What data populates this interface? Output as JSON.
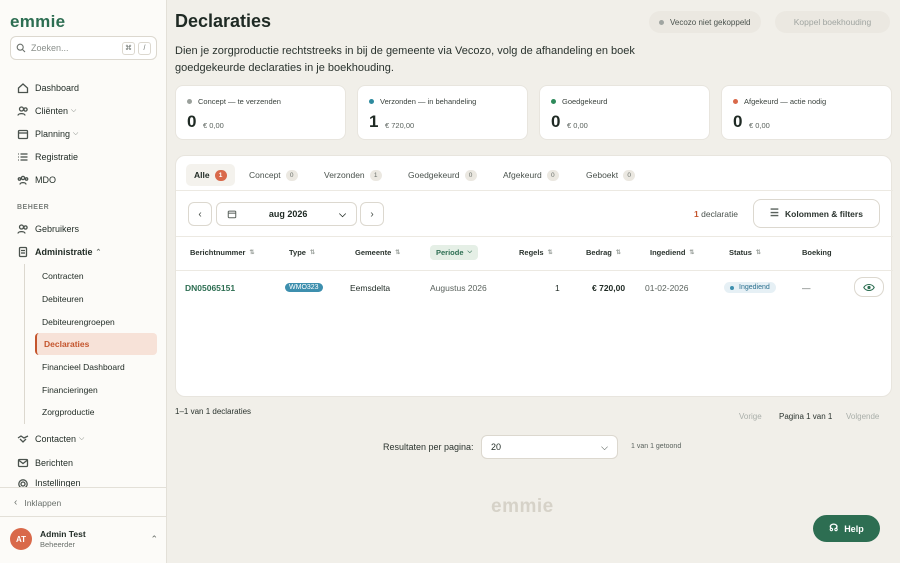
{
  "app": {
    "logo": "emmie",
    "footer_logo": "emmie"
  },
  "search": {
    "placeholder": "Zoeken...",
    "kbd1": "⌘",
    "kbd2": "/"
  },
  "nav": {
    "dashboard": "Dashboard",
    "clienten": "Cliënten",
    "planning": "Planning",
    "registratie": "Registratie",
    "mdo": "MDO",
    "section_beheer": "BEHEER",
    "gebruikers": "Gebruikers",
    "administratie": "Administratie",
    "contacten": "Contacten",
    "berichten": "Berichten",
    "instellingen": "Instellingen"
  },
  "admin_sub": [
    "Contracten",
    "Debiteuren",
    "Debiteurengroepen",
    "Declaraties",
    "Financieel Dashboard",
    "Financieringen",
    "Zorgproductie"
  ],
  "collapse": "Inklappen",
  "user": {
    "initials": "AT",
    "name": "Admin Test",
    "role": "Beheerder"
  },
  "header": {
    "title": "Declaraties",
    "vecozo_status": "Vecozo niet gekoppeld",
    "koppel_button": "Koppel boekhouding",
    "intro": "Dien je zorgproductie rechtstreeks in bij de gemeente via Vecozo, volg de afhandeling en boek goedgekeurde declaraties in je boekhouding."
  },
  "stats": [
    {
      "label": "Concept — te verzenden",
      "count": "0",
      "amount": "€ 0,00",
      "color": "#9aa09b"
    },
    {
      "label": "Verzonden — in behandeling",
      "count": "1",
      "amount": "€ 720,00",
      "color": "#2d8a9e"
    },
    {
      "label": "Goedgekeurd",
      "count": "0",
      "amount": "€ 0,00",
      "color": "#2d8a5a"
    },
    {
      "label": "Afgekeurd — actie nodig",
      "count": "0",
      "amount": "€ 0,00",
      "color": "#d9694a"
    }
  ],
  "tabs": [
    {
      "label": "Alle",
      "count": "1"
    },
    {
      "label": "Concept",
      "count": "0"
    },
    {
      "label": "Verzonden",
      "count": "1"
    },
    {
      "label": "Goedgekeurd",
      "count": "0"
    },
    {
      "label": "Afgekeurd",
      "count": "0"
    },
    {
      "label": "Geboekt",
      "count": "0"
    }
  ],
  "toolbar": {
    "month": "aug 2026",
    "count_num": "1",
    "count_label": "declaratie",
    "filters_button": "Kolommen & filters"
  },
  "columns": [
    "Berichtnummer",
    "Type",
    "Gemeente",
    "Periode",
    "Regels",
    "Bedrag",
    "Ingediend",
    "Status",
    "Boeking"
  ],
  "rows": [
    {
      "berichtnummer": "DN05065151",
      "type": "WMO323",
      "gemeente": "Eemsdelta",
      "periode": "Augustus 2026",
      "regels": "1",
      "bedrag": "€ 720,00",
      "ingediend": "01-02-2026",
      "status": "Ingediend",
      "boeking": "—"
    }
  ],
  "pagination": {
    "range": "1–1 van 1 declaraties",
    "prev": "Vorige",
    "page": "Pagina 1 van 1",
    "next": "Volgende",
    "rpp_label": "Resultaten per pagina:",
    "rpp_value": "20",
    "shown": "1 van 1 getoond"
  },
  "help": "Help"
}
